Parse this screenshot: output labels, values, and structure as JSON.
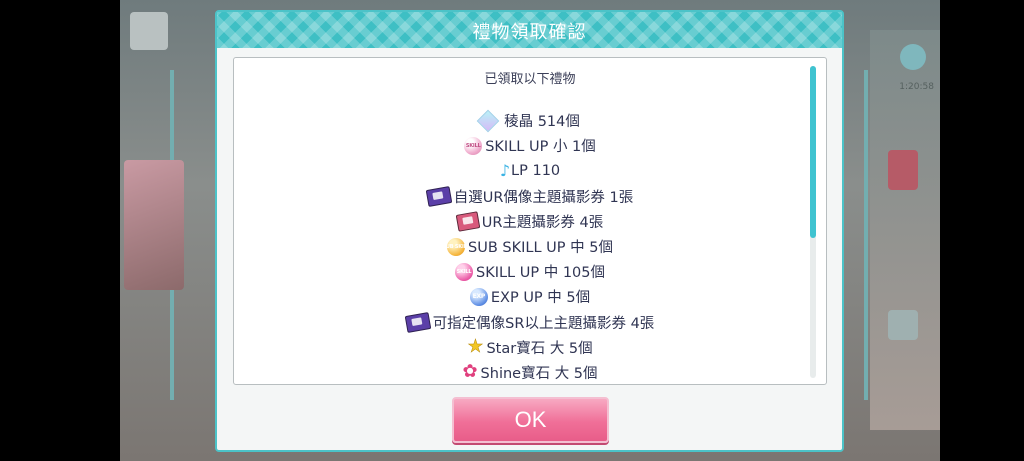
{
  "dialog": {
    "title": "禮物領取確認",
    "intro": "已領取以下禮物",
    "ok_label": "OK"
  },
  "background": {
    "right_text": "1:20:58"
  },
  "gifts": [
    {
      "icon": "crystal-icon",
      "icon_text": "",
      "text": "稜晶 514個"
    },
    {
      "icon": "skill-up-small-icon",
      "icon_text": "SKILL",
      "text": "SKILL UP 小 1個"
    },
    {
      "icon": "music-note-icon",
      "icon_text": "♪",
      "text": "LP 110"
    },
    {
      "icon": "ticket-icon",
      "icon_text": "",
      "text": "自選UR偶像主題攝影券 1張"
    },
    {
      "icon": "ur-ticket-icon",
      "icon_text": "",
      "text": "UR主題攝影券 4張"
    },
    {
      "icon": "sub-skill-up-icon",
      "icon_text": "SUB SKILL",
      "text": "SUB SKILL UP 中 5個"
    },
    {
      "icon": "skill-up-medium-icon",
      "icon_text": "SKILL",
      "text": "SKILL UP 中 105個"
    },
    {
      "icon": "exp-up-icon",
      "icon_text": "EXP",
      "text": "EXP UP 中 5個"
    },
    {
      "icon": "ticket-icon",
      "icon_text": "",
      "text": "可指定偶像SR以上主題攝影券 4張"
    },
    {
      "icon": "star-icon",
      "icon_text": "★",
      "text": "Star寶石 大 5個"
    },
    {
      "icon": "flower-icon",
      "icon_text": "✿",
      "text": "Shine寶石 大 5個"
    }
  ],
  "colors": {
    "accent": "#3ebfc4",
    "ok_button": "#f06f98",
    "text": "#303553"
  }
}
